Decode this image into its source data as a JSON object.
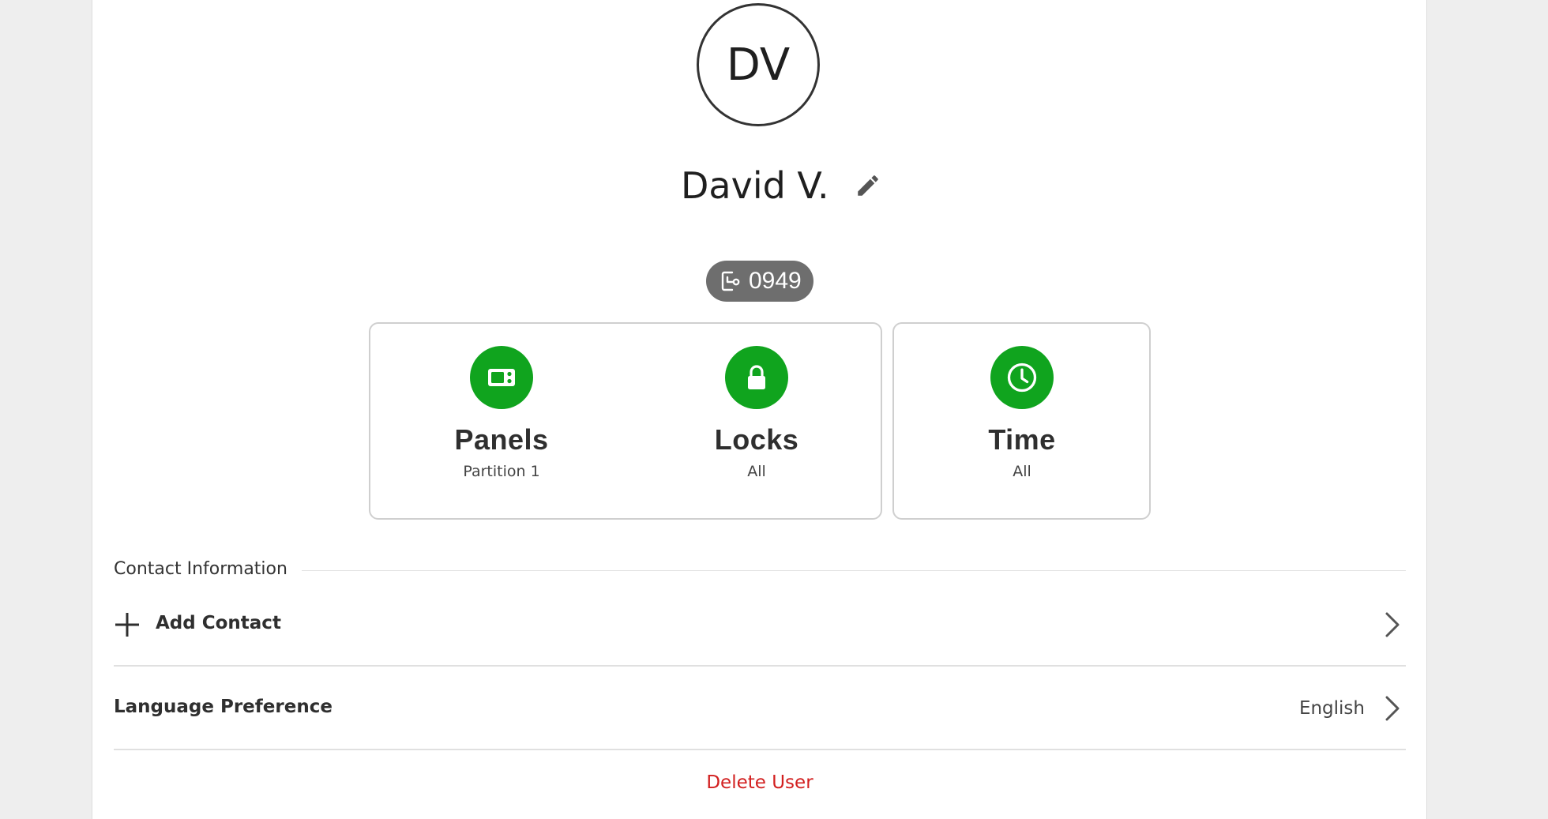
{
  "user": {
    "initials": "DV",
    "name": "David V.",
    "pin": "0949"
  },
  "tiles": [
    {
      "title": "Panels",
      "subtitle": "Partition 1",
      "icon": "panel-icon"
    },
    {
      "title": "Locks",
      "subtitle": "All",
      "icon": "lock-icon"
    },
    {
      "title": "Time",
      "subtitle": "All",
      "icon": "clock-icon"
    }
  ],
  "contact": {
    "section_title": "Contact Information",
    "add_label": "Add Contact"
  },
  "language": {
    "label": "Language Preference",
    "value": "English"
  },
  "actions": {
    "delete_label": "Delete User"
  },
  "colors": {
    "accent_green": "#10a41e",
    "danger_red": "#d21f1f",
    "badge_gray": "#6e6e6e"
  }
}
